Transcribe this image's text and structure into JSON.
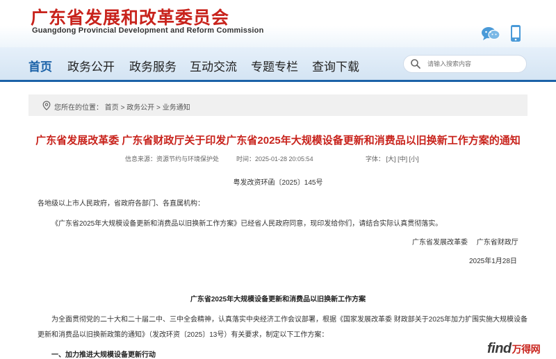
{
  "header": {
    "title_zh": "广东省发展和改革委员会",
    "title_en": "Guangdong Provincial Development and Reform Commission",
    "brand_color": "#c8231c",
    "icons": [
      "wechat-icon",
      "mobile-icon"
    ]
  },
  "nav": {
    "items": [
      {
        "label": "首页"
      },
      {
        "label": "政务公开"
      },
      {
        "label": "政务服务"
      },
      {
        "label": "互动交流"
      },
      {
        "label": "专题专栏"
      },
      {
        "label": "查询下载"
      }
    ],
    "active_index": 0,
    "accent_color": "#1b62a8"
  },
  "search": {
    "placeholder": "请输入搜索内容"
  },
  "breadcrumb": {
    "prefix": "您所在的位置：",
    "items": [
      "首页",
      "政务公开",
      "业务通知"
    ],
    "separator": " > "
  },
  "article": {
    "title": "广东省发展改革委 广东省财政厅关于印发广东省2025年大规模设备更新和消费品以旧换新工作方案的通知",
    "source_label": "信息来源：资源节约与环境保护处",
    "time_label": "时间：2025-01-28 20:05:54",
    "font_label": "字体：",
    "font_sizes": [
      "[大]",
      "[中]",
      "[小]"
    ],
    "doc_number": "粤发改资环函〔2025〕145号",
    "recipients": "各地级以上市人民政府，省政府各部门、各直属机构：",
    "body": "《广东省2025年大规模设备更新和消费品以旧换新工作方案》已经省人民政府同意，现印发给你们，请结合实际认真贯彻落实。",
    "signatories": "广东省发展改革委　 广东省财政厅",
    "date": "2025年1月28日",
    "plan_title": "广东省2025年大规模设备更新和消费品以旧换新工作方案",
    "plan_para_line1": "为全面贯彻党的二十大和二十届二中、三中全会精神，认真落实中央经济工作会议部署，根据《国家发展改革委 财政部关于2025年加力扩围实施大规模设备",
    "plan_para_line2": "更新和消费品以旧换新政策的通知》（发改环资〔2025〕13号）有关要求，制定以下工作方案：",
    "section_1": "一、加力推进大规模设备更新行动"
  },
  "watermark": {
    "en": "find",
    "zh": "万得网"
  }
}
